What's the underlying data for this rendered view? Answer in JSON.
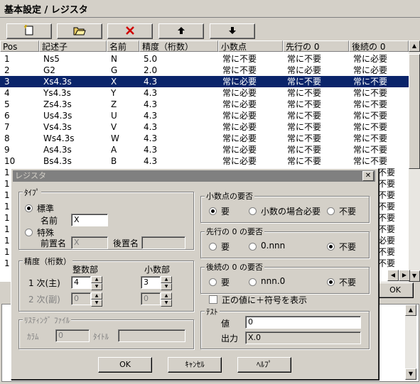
{
  "window": {
    "title": "基本設定 / レジスタ"
  },
  "toolbar": [
    {
      "icon": "new-file-icon"
    },
    {
      "icon": "open-folder-icon"
    },
    {
      "icon": "delete-icon"
    },
    {
      "icon": "arrow-up-icon"
    },
    {
      "icon": "arrow-down-icon"
    }
  ],
  "grid": {
    "columns": [
      "Pos",
      "記述子",
      "名前",
      "精度（桁数）",
      "小数点",
      "先行の 0",
      "後続の 0"
    ],
    "rows": [
      [
        "1",
        "Ns5",
        "N",
        "5.0",
        "常に不要",
        "常に不要",
        "常に必要"
      ],
      [
        "2",
        "G2",
        "G",
        "2.0",
        "常に不要",
        "常に必要",
        "常に必要"
      ],
      [
        "3",
        "Xs4.3s",
        "X",
        "4.3",
        "常に必要",
        "常に不要",
        "常に不要"
      ],
      [
        "4",
        "Ys4.3s",
        "Y",
        "4.3",
        "常に必要",
        "常に不要",
        "常に不要"
      ],
      [
        "5",
        "Zs4.3s",
        "Z",
        "4.3",
        "常に必要",
        "常に不要",
        "常に不要"
      ],
      [
        "6",
        "Us4.3s",
        "U",
        "4.3",
        "常に必要",
        "常に不要",
        "常に不要"
      ],
      [
        "7",
        "Vs4.3s",
        "V",
        "4.3",
        "常に必要",
        "常に不要",
        "常に不要"
      ],
      [
        "8",
        "Ws4.3s",
        "W",
        "4.3",
        "常に必要",
        "常に不要",
        "常に不要"
      ],
      [
        "9",
        "As4.3s",
        "A",
        "4.3",
        "常に必要",
        "常に不要",
        "常に不要"
      ],
      [
        "10",
        "Bs4.3s",
        "B",
        "4.3",
        "常に必要",
        "常に不要",
        "常に不要"
      ]
    ],
    "selected_index": 2,
    "hidden_partial": [
      "不要",
      "不要",
      "不要",
      "不要",
      "不要",
      "不要",
      "必要",
      "不要",
      "不要"
    ],
    "partial_row_prefix": "1"
  },
  "back_ok_label": "OK",
  "dialog": {
    "title": "レジスタ",
    "close": "✕",
    "type_group": {
      "label": "ﾀｲﾌﾟ",
      "standard": "標準",
      "name_label": "名前",
      "name_value": "X",
      "special": "特殊",
      "prefix_label": "前置名",
      "prefix_value": "X",
      "suffix_label": "後置名",
      "suffix_value": ""
    },
    "precision_group": {
      "label": "精度（桁数）",
      "int_header": "整数部",
      "dec_header": "小数部",
      "row1_label": "1 次(主)",
      "row1_int": "4",
      "row1_dec": "3",
      "row2_label": "2 次(副)",
      "row2_int": "0",
      "row2_dec": "0"
    },
    "listing_group": {
      "label": "ﾘｽﾃｨﾝｸﾞ ﾌｧｲﾙ",
      "column_label": "ｶﾗﾑ",
      "column_value": "0",
      "title_label": "ﾀｲﾄﾙ",
      "title_value": ""
    },
    "decimal_group": {
      "label": "小数点の要否",
      "opt1": "要",
      "opt2": "小数の場合必要",
      "opt3": "不要"
    },
    "leading_group": {
      "label": "先行の 0 の要否",
      "opt1": "要",
      "opt2": "0.nnn",
      "opt3": "不要"
    },
    "trailing_group": {
      "label": "後続の 0 の要否",
      "opt1": "要",
      "opt2": "nnn.0",
      "opt3": "不要"
    },
    "plus_sign": "正の値に＋符号を表示",
    "test_group": {
      "label": "ﾃｽﾄ",
      "value_label": "値",
      "value": "0",
      "output_label": "出力",
      "output": "X.0"
    },
    "buttons": {
      "ok": "OK",
      "cancel": "ｷｬﾝｾﾙ",
      "help": "ﾍﾙﾌﾟ"
    }
  }
}
